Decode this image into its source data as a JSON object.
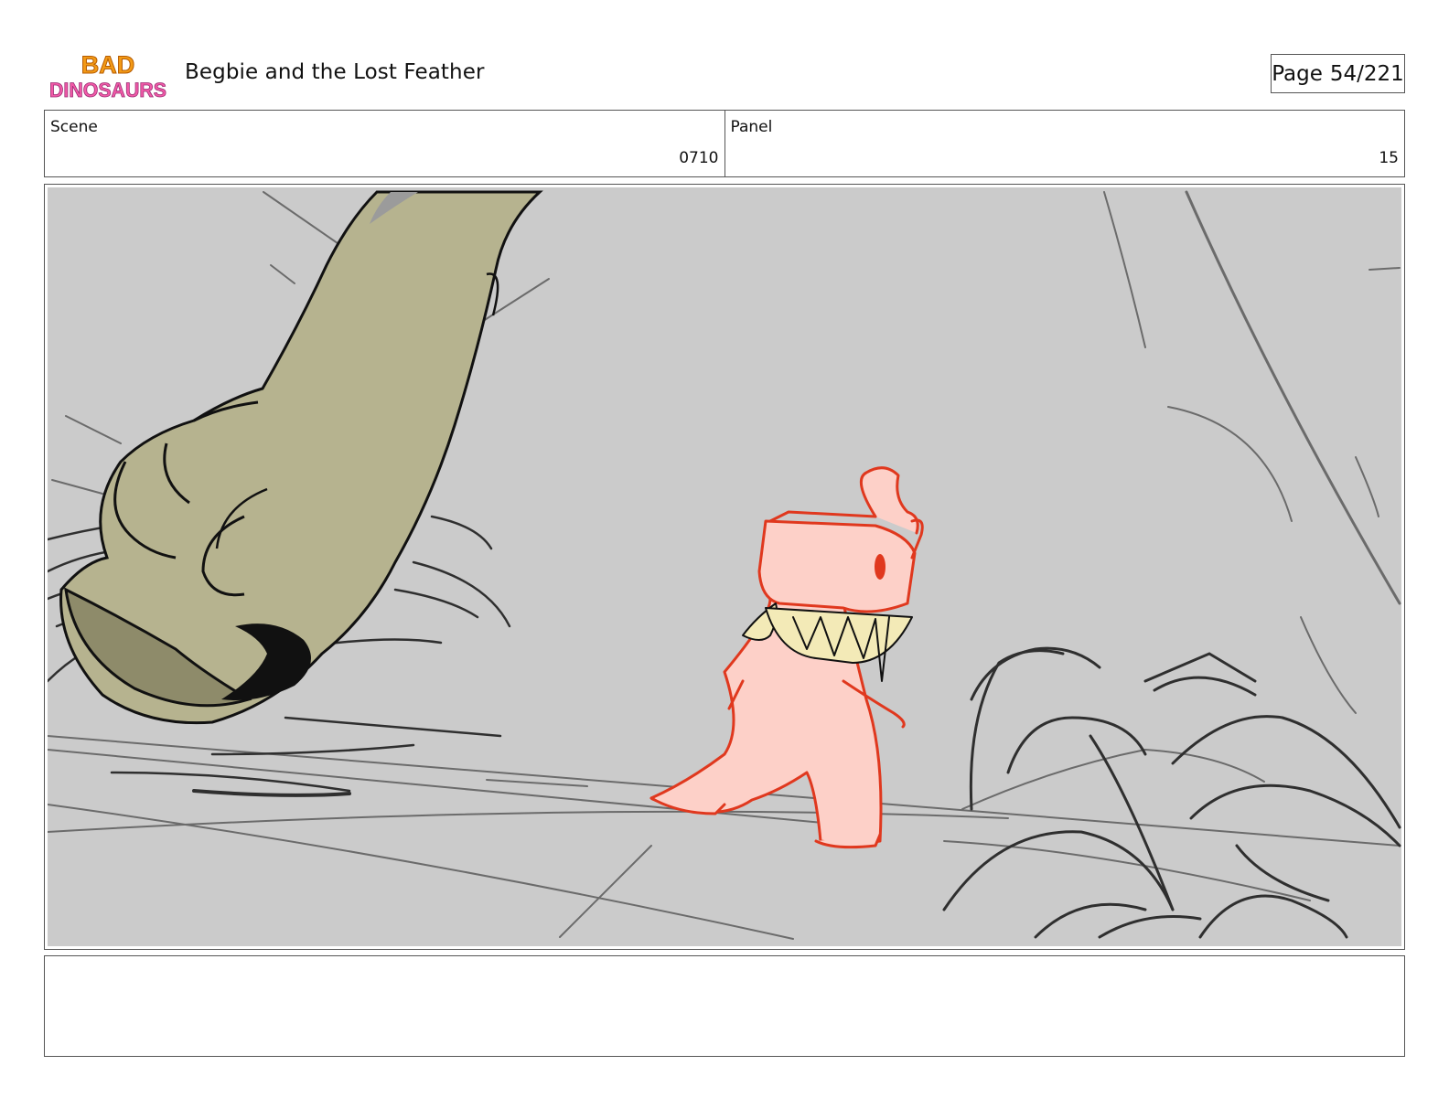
{
  "header": {
    "logo_text_top": "BAD",
    "logo_text_bottom": "DINOSAURS",
    "title": "Begbie and the Lost Feather",
    "page_label": "Page",
    "page_value": "54/221"
  },
  "info": {
    "scene_label": "Scene",
    "scene_value": "0710",
    "panel_label": "Panel",
    "panel_value": "15"
  },
  "notes": "",
  "colors": {
    "background_sky": "#cbcbcb",
    "dinosaur_foot": "#b6b38f",
    "character_fill": "#fdd0c8",
    "character_line": "#e0381e",
    "teeth": "#f3eab7"
  }
}
